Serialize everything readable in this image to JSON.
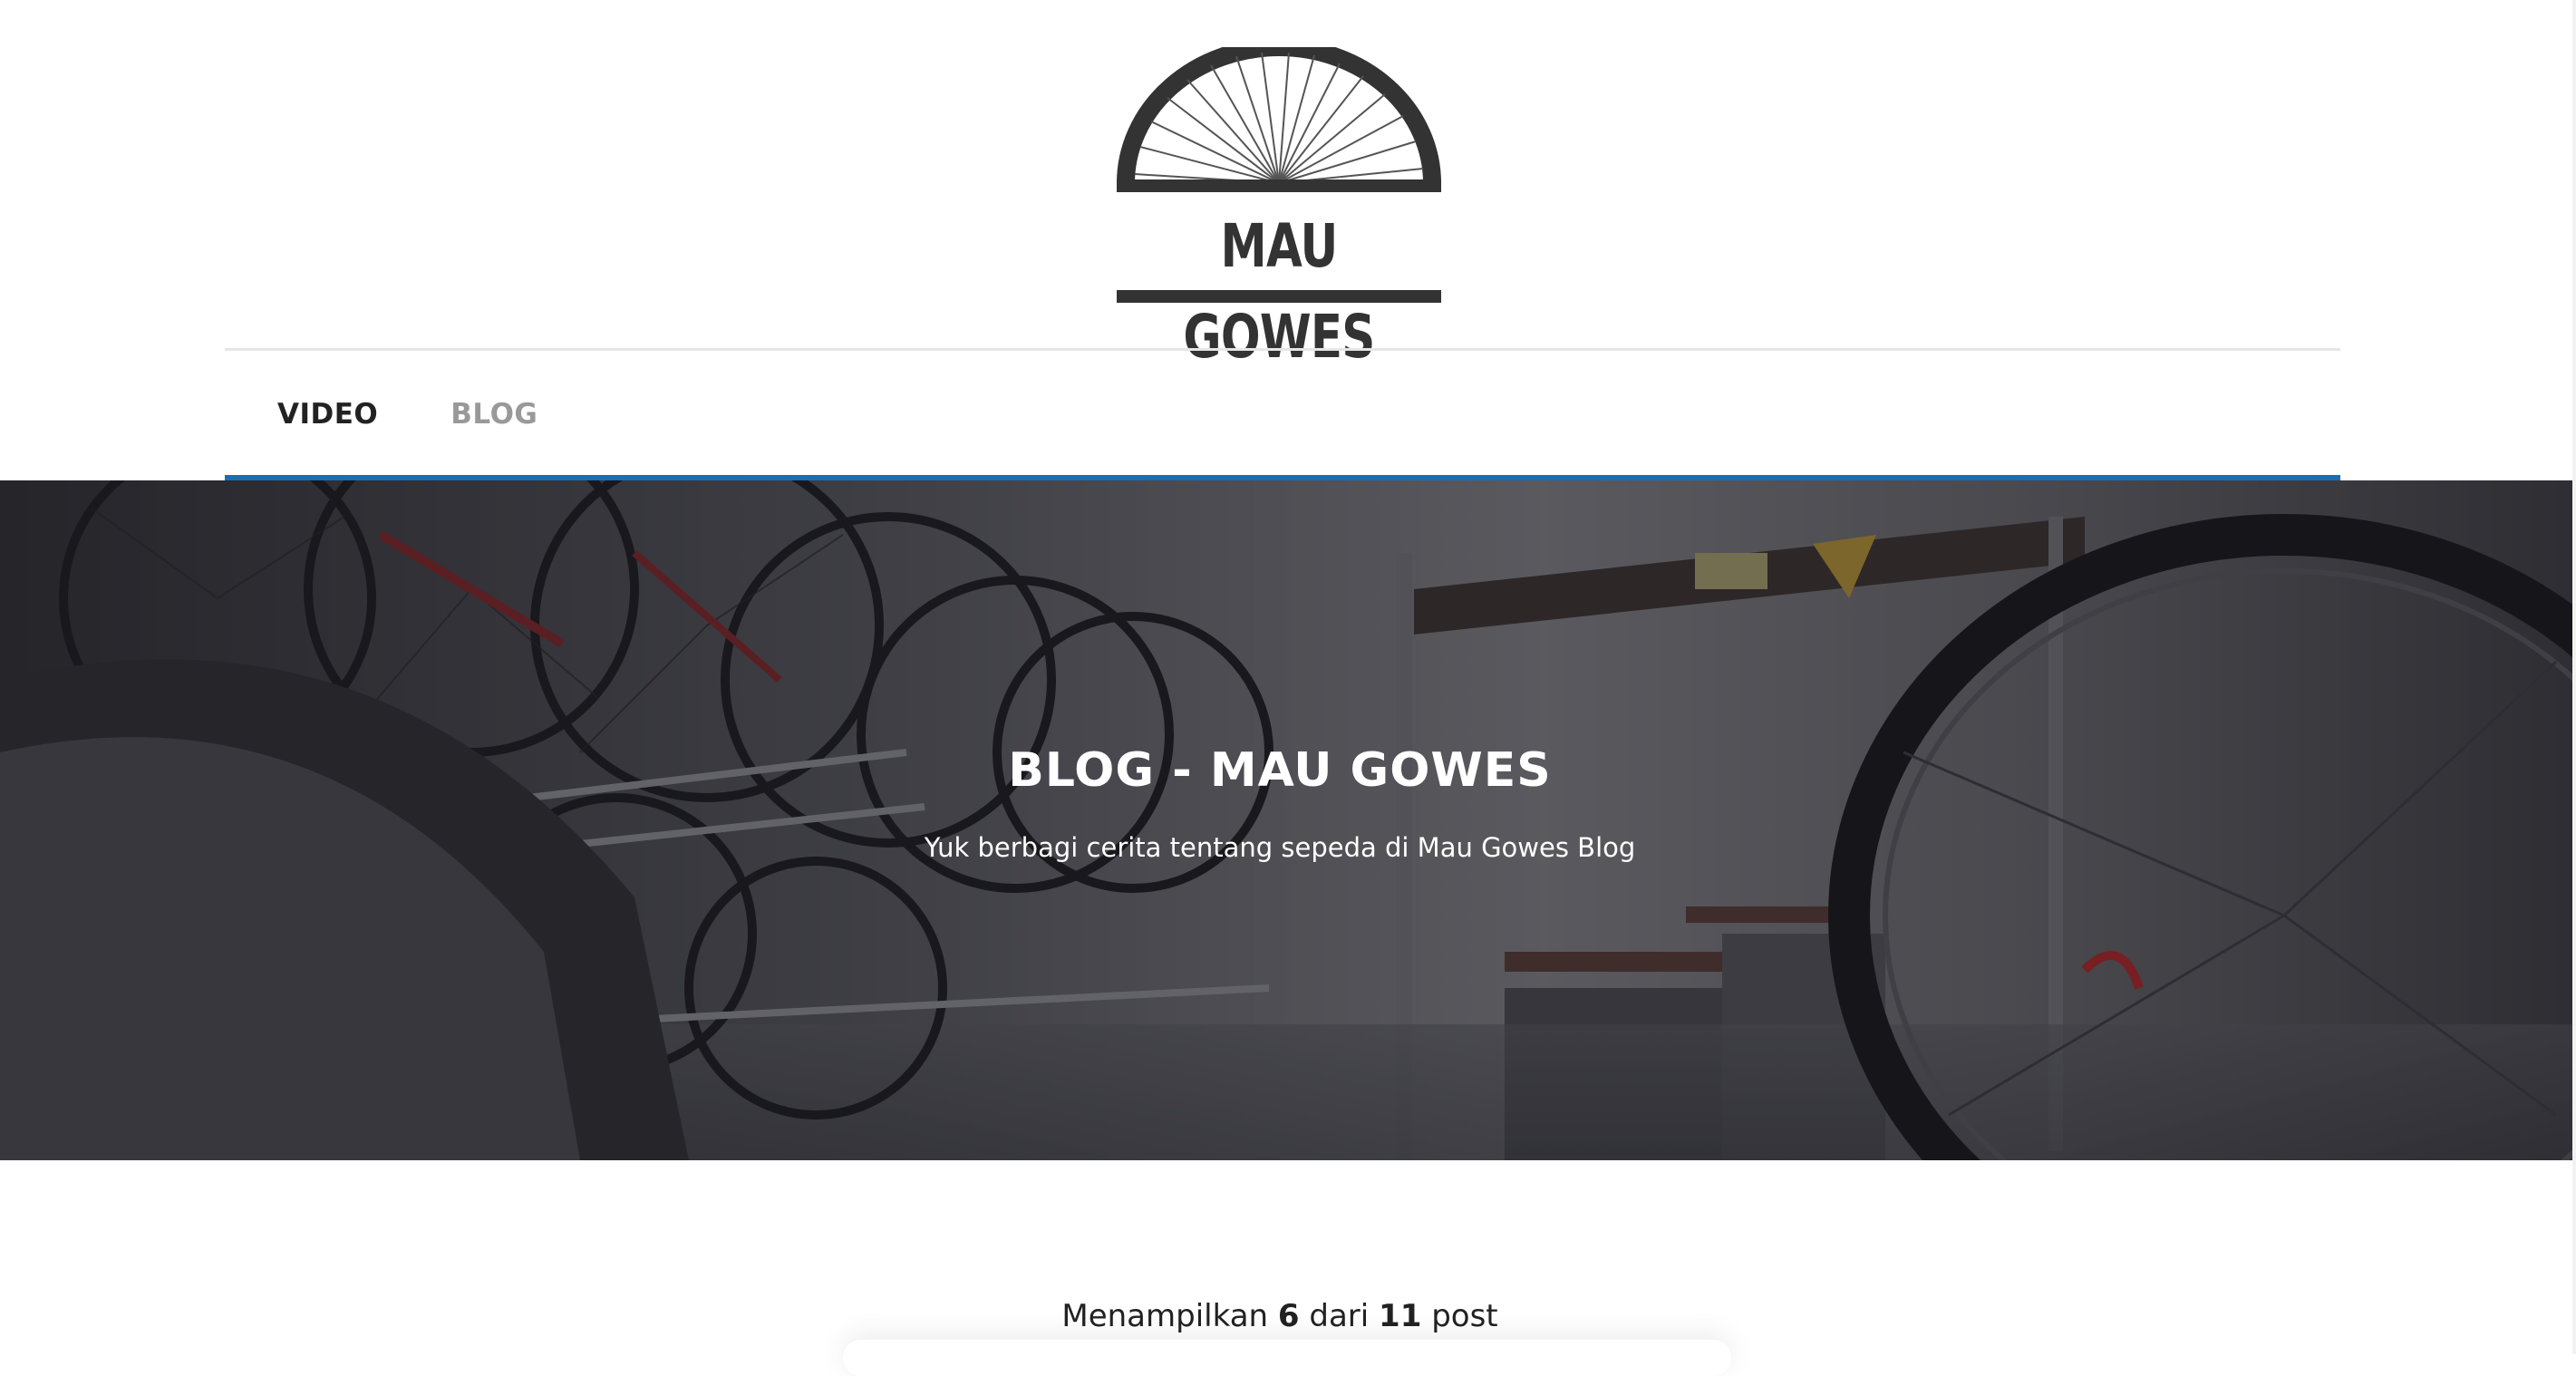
{
  "brand": {
    "logo_text": "MAU GOWES"
  },
  "nav": {
    "items": [
      {
        "label": "VIDEO",
        "active": true
      },
      {
        "label": "BLOG",
        "active": false
      }
    ],
    "underline_color": "#1b6fb0"
  },
  "hero": {
    "title": "BLOG - MAU GOWES",
    "subtitle": "Yuk berbagi cerita tentang sepeda di Mau Gowes Blog"
  },
  "posts_summary": {
    "prefix": "Menampilkan",
    "shown": "6",
    "middle": "dari",
    "total": "11",
    "suffix": "post"
  }
}
